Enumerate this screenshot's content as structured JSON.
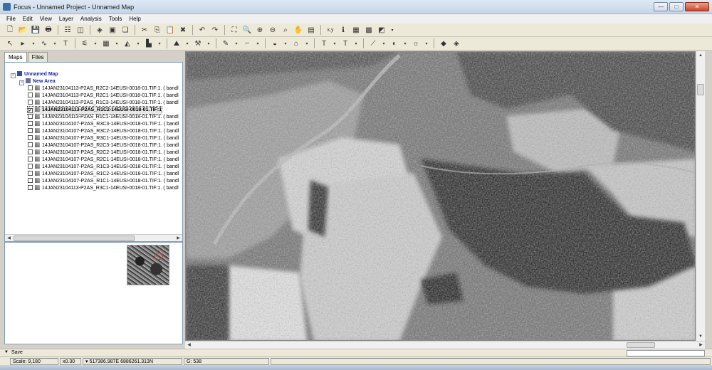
{
  "window": {
    "title": "Focus - Unnamed Project - Unnamed Map",
    "min": "—",
    "max": "□",
    "close": "✕"
  },
  "menu": [
    "File",
    "Edit",
    "View",
    "Layer",
    "Analysis",
    "Tools",
    "Help"
  ],
  "toolbar1": [
    "new-icon",
    "open-icon",
    "save-icon",
    "print-icon",
    "sep",
    "properties-icon",
    "view-icon",
    "sep",
    "eraser-icon",
    "frame-icon",
    "layers-icon",
    "sep",
    "cut-icon",
    "copy-icon",
    "paste-icon",
    "delete-icon",
    "sep",
    "undo-icon",
    "redo-icon",
    "sep",
    "zoom-extent-icon",
    "zoom-box-icon",
    "zoom-in-icon",
    "zoom-out-icon",
    "zoom-window-icon",
    "pan-icon",
    "zoom-1to1-icon",
    "sep",
    "xy-icon",
    "info-icon",
    "table-icon",
    "grid-icon",
    "chart-icon",
    "dd"
  ],
  "toolbar1_glyphs": {
    "new-icon": "🗋",
    "open-icon": "📂",
    "save-icon": "💾",
    "print-icon": "🖶",
    "properties-icon": "☷",
    "view-icon": "◫",
    "eraser-icon": "◈",
    "frame-icon": "▣",
    "layers-icon": "❏",
    "cut-icon": "✂",
    "copy-icon": "⎘",
    "paste-icon": "📋",
    "delete-icon": "✖",
    "undo-icon": "↶",
    "redo-icon": "↷",
    "zoom-extent-icon": "⛶",
    "zoom-box-icon": "🔍",
    "zoom-in-icon": "⊕",
    "zoom-out-icon": "⊖",
    "zoom-window-icon": "⌕",
    "pan-icon": "✋",
    "zoom-1to1-icon": "▤",
    "xy-icon": "x,y",
    "info-icon": "ℹ",
    "table-icon": "▦",
    "grid-icon": "▩",
    "chart-icon": "◩",
    "dd": "▾"
  },
  "toolbar2": [
    "select-icon",
    "arrow-icon",
    "dd",
    "polyline-icon",
    "dd",
    "text-icon",
    "sep",
    "brush-icon",
    "dd",
    "classify-icon",
    "dd",
    "fill-icon",
    "dd",
    "export-icon",
    "dd",
    "sep",
    "terrain-icon",
    "dd",
    "tools-icon",
    "dd",
    "sep",
    "pen-color-icon",
    "dd",
    "line-style-icon",
    "dd",
    "sep",
    "fill-color-icon",
    "dd",
    "symbol-icon",
    "dd",
    "sep",
    "text-style-icon",
    "dd",
    "text-size-icon",
    "dd",
    "sep",
    "curve-icon",
    "dd",
    "opacity-icon",
    "dd",
    "light-icon",
    "dd",
    "sep",
    "layer-a-icon",
    "layer-b-icon"
  ],
  "toolbar2_glyphs": {
    "select-icon": "↖",
    "arrow-icon": "▸",
    "polyline-icon": "∿",
    "text-icon": "T",
    "brush-icon": "⚟",
    "classify-icon": "▦",
    "fill-icon": "◭",
    "export-icon": "▙",
    "terrain-icon": "⛰",
    "tools-icon": "⚒",
    "pen-color-icon": "✎",
    "line-style-icon": "┄",
    "fill-color-icon": "◒",
    "symbol-icon": "⌂",
    "text-style-icon": "T",
    "text-size-icon": "T",
    "curve-icon": "⟋",
    "opacity-icon": "◐",
    "light-icon": "☼",
    "layer-a-icon": "◆",
    "layer-b-icon": "◈",
    "dd": "▾"
  },
  "panel": {
    "tabs": [
      "Maps",
      "Files"
    ],
    "tree": [
      {
        "label": "Unnamed Map",
        "style": "blue",
        "indent": 0,
        "kind": "map"
      },
      {
        "label": "New Area",
        "style": "blue",
        "indent": 1,
        "kind": "area"
      },
      {
        "label": "14JAN23104113-P2AS_R2C2-14EUSI-0018-01.TIF:1. ( bandl",
        "indent": 2,
        "checked": false
      },
      {
        "label": "14JAN23104113-P2AS_R2C1-14EUSI-0018-01.TIF:1. ( bandl",
        "indent": 2,
        "checked": false
      },
      {
        "label": "14JAN23104113-P2AS_R1C3-14EUSI-0018-01.TIF:1. ( bandl",
        "indent": 2,
        "checked": false
      },
      {
        "label": "14JAN23104113-P2AS_R1C2-14EUSI-0018-01.TIF:1",
        "indent": 2,
        "checked": true,
        "style": "bold",
        "selected": true
      },
      {
        "label": "14JAN23104113-P2AS_R1C1-14EUSI-0018-01.TIF:1. ( bandl",
        "indent": 2,
        "checked": false
      },
      {
        "label": "14JAN23104107-P2AS_R3C3-14EUSI-0018-01.TIF:1. ( bandl",
        "indent": 2,
        "checked": false
      },
      {
        "label": "14JAN23104107-P2AS_R3C2-14EUSI-0018-01.TIF:1. ( bandl",
        "indent": 2,
        "checked": false
      },
      {
        "label": "14JAN23104107-P2AS_R3C1-14EUSI-0018-01.TIF:1. ( bandl",
        "indent": 2,
        "checked": false
      },
      {
        "label": "14JAN23104107-P2AS_R2C3-14EUSI-0018-01.TIF:1. ( bandl",
        "indent": 2,
        "checked": false
      },
      {
        "label": "14JAN23104107-P2AS_R2C2-14EUSI-0018-01.TIF:1. ( bandl",
        "indent": 2,
        "checked": false
      },
      {
        "label": "14JAN23104107-P2AS_R2C1-14EUSI-0018-01.TIF:1. ( bandl",
        "indent": 2,
        "checked": false
      },
      {
        "label": "14JAN23104107-P2AS_R1C3-14EUSI-0018-01.TIF:1. ( bandl",
        "indent": 2,
        "checked": false
      },
      {
        "label": "14JAN23104107-P2AS_R1C2-14EUSI-0018-01.TIF:1. ( bandl",
        "indent": 2,
        "checked": false
      },
      {
        "label": "14JAN23104107-P2AS_R1C1-14EUSI-0018-01.TIF:1. ( bandl",
        "indent": 2,
        "checked": false
      },
      {
        "label": "14JAN23104113-P2AS_R3C1-14EUSI-0018-01.TIF:1. ( bandl",
        "indent": 2,
        "checked": false
      }
    ]
  },
  "savebar": {
    "label": "Save"
  },
  "status": {
    "scale": "Scale: 9,180",
    "zoom": "x0.30",
    "coords": "517386.987E 6886261.313N",
    "value": "G:  538"
  }
}
